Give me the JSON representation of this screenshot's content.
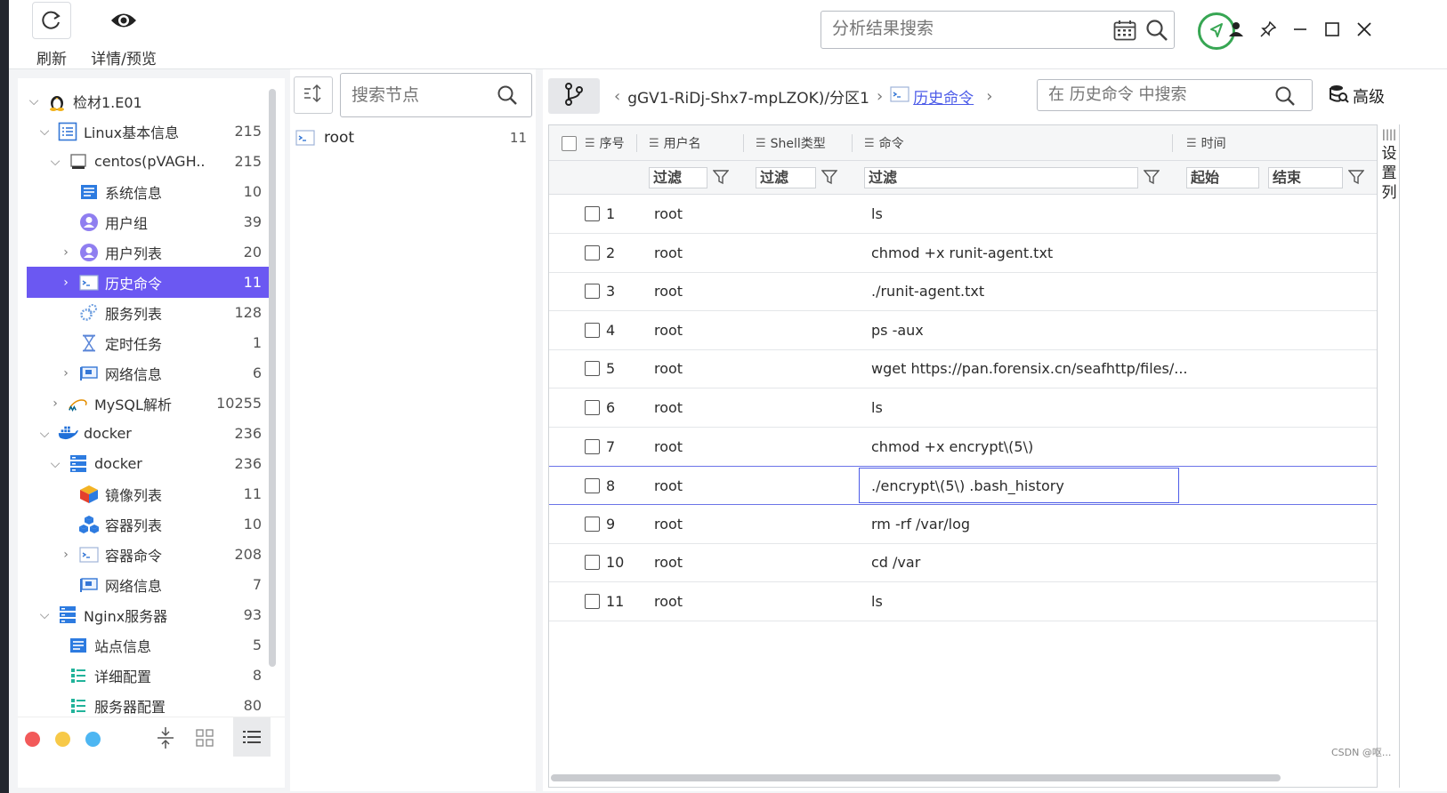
{
  "toolbar": {
    "refresh_label": "刷新",
    "preview_label": "详情/预览",
    "search_placeholder": "分析结果搜索"
  },
  "tree": {
    "items": [
      {
        "label": "检材1.E01",
        "count": ""
      },
      {
        "label": "Linux基本信息",
        "count": "215"
      },
      {
        "label": "centos(pVAGH...",
        "count": "215"
      },
      {
        "label": "系统信息",
        "count": "10"
      },
      {
        "label": "用户组",
        "count": "39"
      },
      {
        "label": "用户列表",
        "count": "20"
      },
      {
        "label": "历史命令",
        "count": "11"
      },
      {
        "label": "服务列表",
        "count": "128"
      },
      {
        "label": "定时任务",
        "count": "1"
      },
      {
        "label": "网络信息",
        "count": "6"
      },
      {
        "label": "MySQL解析",
        "count": "10255"
      },
      {
        "label": "docker",
        "count": "236"
      },
      {
        "label": "docker",
        "count": "236"
      },
      {
        "label": "镜像列表",
        "count": "11"
      },
      {
        "label": "容器列表",
        "count": "10"
      },
      {
        "label": "容器命令",
        "count": "208"
      },
      {
        "label": "网络信息",
        "count": "7"
      },
      {
        "label": "Nginx服务器",
        "count": "93"
      },
      {
        "label": "站点信息",
        "count": "5"
      },
      {
        "label": "详细配置",
        "count": "8"
      },
      {
        "label": "服务器配置",
        "count": "80"
      }
    ],
    "dot_colors": [
      "#f25a5a",
      "#f7c948",
      "#4db6f2"
    ]
  },
  "mid": {
    "search_placeholder": "搜索节点",
    "node": {
      "label": "root",
      "count": "11"
    }
  },
  "breadcrumb": {
    "path": "gGV1-RiDj-Shx7-mpLZOK)/分区1",
    "current": "历史命令"
  },
  "history_search_placeholder": "在 历史命令 中搜索",
  "advanced_label": "高级",
  "settings_label": [
    "设",
    "置",
    "列"
  ],
  "table": {
    "headers": {
      "seq": "序号",
      "user": "用户名",
      "shell": "Shell类型",
      "cmd": "命令",
      "time": "时间"
    },
    "filter": {
      "placeholder": "过滤",
      "start": "起始",
      "end": "结束"
    },
    "rows": [
      {
        "seq": "1",
        "user": "root",
        "cmd": "ls"
      },
      {
        "seq": "2",
        "user": "root",
        "cmd": "chmod +x runit-agent.txt"
      },
      {
        "seq": "3",
        "user": "root",
        "cmd": "./runit-agent.txt"
      },
      {
        "seq": "4",
        "user": "root",
        "cmd": "ps -aux"
      },
      {
        "seq": "5",
        "user": "root",
        "cmd": "wget https://pan.forensix.cn/seafhttp/files/..."
      },
      {
        "seq": "6",
        "user": "root",
        "cmd": "ls"
      },
      {
        "seq": "7",
        "user": "root",
        "cmd": "chmod +x encrypt\\(5\\)"
      },
      {
        "seq": "8",
        "user": "root",
        "cmd": "./encrypt\\(5\\) .bash_history"
      },
      {
        "seq": "9",
        "user": "root",
        "cmd": "rm -rf /var/log"
      },
      {
        "seq": "10",
        "user": "root",
        "cmd": "cd /var"
      },
      {
        "seq": "11",
        "user": "root",
        "cmd": "ls"
      }
    ]
  },
  "credit": "CSDN @呕..."
}
